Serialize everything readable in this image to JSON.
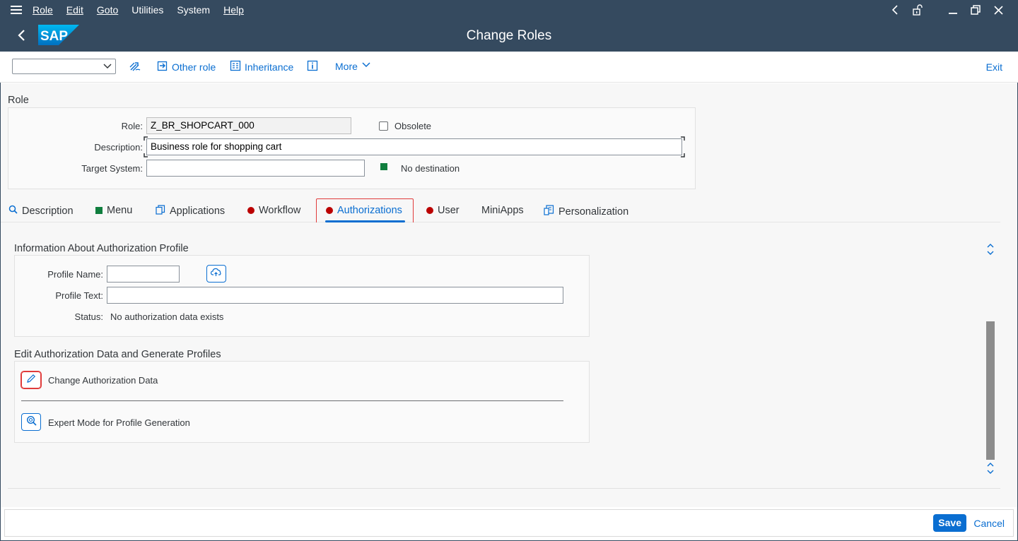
{
  "menubar": {
    "items": [
      {
        "label": "Role"
      },
      {
        "label": "Edit"
      },
      {
        "label": "Goto"
      },
      {
        "label": "Utilities"
      },
      {
        "label": "System"
      },
      {
        "label": "Help"
      }
    ]
  },
  "titlebar": {
    "logo": "SAP",
    "title": "Change Roles"
  },
  "toolbar": {
    "select_value": "",
    "other_role": "Other role",
    "inheritance": "Inheritance",
    "more": "More",
    "exit": "Exit",
    "icons": [
      "transport-icon",
      "other-role-icon",
      "inheritance-icon",
      "info-icon",
      "chevron-down-icon"
    ]
  },
  "role_section": {
    "title": "Role",
    "role_label": "Role:",
    "role_value": "Z_BR_SHOPCART_000",
    "obsolete_label": "Obsolete",
    "description_label": "Description:",
    "description_value": "Business role for shopping cart",
    "target_system_label": "Target System:",
    "target_system_value": "",
    "destination_text": "No destination",
    "status_color": "#107e3e"
  },
  "tabs": [
    {
      "label": "Description",
      "marker": "search-icon"
    },
    {
      "label": "Menu",
      "marker": "green-square"
    },
    {
      "label": "Applications",
      "marker": "copy-icon"
    },
    {
      "label": "Workflow",
      "marker": "red-dot"
    },
    {
      "label": "Authorizations",
      "marker": "red-dot",
      "active": true
    },
    {
      "label": "User",
      "marker": "red-dot"
    },
    {
      "label": "MiniApps",
      "marker": ""
    },
    {
      "label": "Personalization",
      "marker": "personalization-icon"
    }
  ],
  "auth_profile": {
    "title": "Information About Authorization Profile",
    "profile_name_label": "Profile Name:",
    "profile_name_value": "",
    "profile_text_label": "Profile Text:",
    "profile_text_value": "",
    "status_label": "Status:",
    "status_value": "No authorization data exists"
  },
  "edit_auth": {
    "title": "Edit Authorization Data and Generate Profiles",
    "change_auth": "Change Authorization Data",
    "expert_mode": "Expert Mode for Profile Generation"
  },
  "footer": {
    "save": "Save",
    "cancel": "Cancel"
  },
  "colors": {
    "shell": "#354a5f",
    "accent": "#0a6ed1",
    "error": "#bb0000",
    "success": "#107e3e",
    "highlight": "#e03b3b"
  }
}
